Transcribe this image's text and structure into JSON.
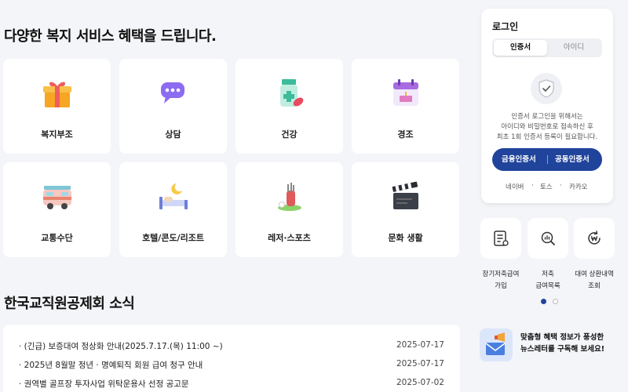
{
  "main": {
    "services_title": "다양한 복지 서비스 혜택을 드립니다.",
    "services": [
      {
        "label": "복지부조",
        "icon": "gift-icon"
      },
      {
        "label": "상담",
        "icon": "chat-bubble-icon"
      },
      {
        "label": "건강",
        "icon": "medicine-icon"
      },
      {
        "label": "경조",
        "icon": "calendar-cake-icon"
      },
      {
        "label": "교통수단",
        "icon": "camper-van-icon"
      },
      {
        "label": "호텔/콘도/리조트",
        "icon": "bed-moon-icon"
      },
      {
        "label": "레저·스포츠",
        "icon": "golf-bag-icon"
      },
      {
        "label": "문화 생활",
        "icon": "clapperboard-icon"
      }
    ],
    "news_title": "한국교직원공제회 소식",
    "news": [
      {
        "text": "· (긴급) 보증대여 정상화 안내(2025.7.17.(목) 11:00 ~)",
        "date": "2025-07-17"
      },
      {
        "text": "· 2025년 8월말 정년 · 명예퇴직 회원 급여 청구 안내",
        "date": "2025-07-17"
      },
      {
        "text": "· 권역별 골프장 투자사업 위탁운용사 선정 공고문",
        "date": "2025-07-02"
      }
    ]
  },
  "login": {
    "title": "로그인",
    "tabs": [
      "인증서",
      "아이디"
    ],
    "desc_lines": [
      "인증서 로그인을 위해서는",
      "아이디와 비밀번호로 접속하신 후",
      "최초 1회 인증서 등록이 필요합니다."
    ],
    "btn_financial": "금융인증서",
    "btn_public": "공동인증서",
    "social": [
      "네이버",
      "·",
      "토스",
      "·",
      "카카오"
    ]
  },
  "quick": [
    {
      "lines": [
        "장기저축급여",
        "가입"
      ],
      "icon": "document-icon"
    },
    {
      "lines": [
        "저축",
        "급여목록"
      ],
      "icon": "magnifier-chart-icon"
    },
    {
      "lines": [
        "대여 상환내역",
        "조회"
      ],
      "icon": "won-refresh-icon"
    }
  ],
  "newsletter": {
    "lines": [
      "맞춤형 혜택 정보가 풍성한",
      "뉴스레터를 구독해 보세요!"
    ]
  },
  "colors": {
    "brand": "#20449b",
    "bg": "#f4f5f8",
    "card": "#ffffff"
  }
}
